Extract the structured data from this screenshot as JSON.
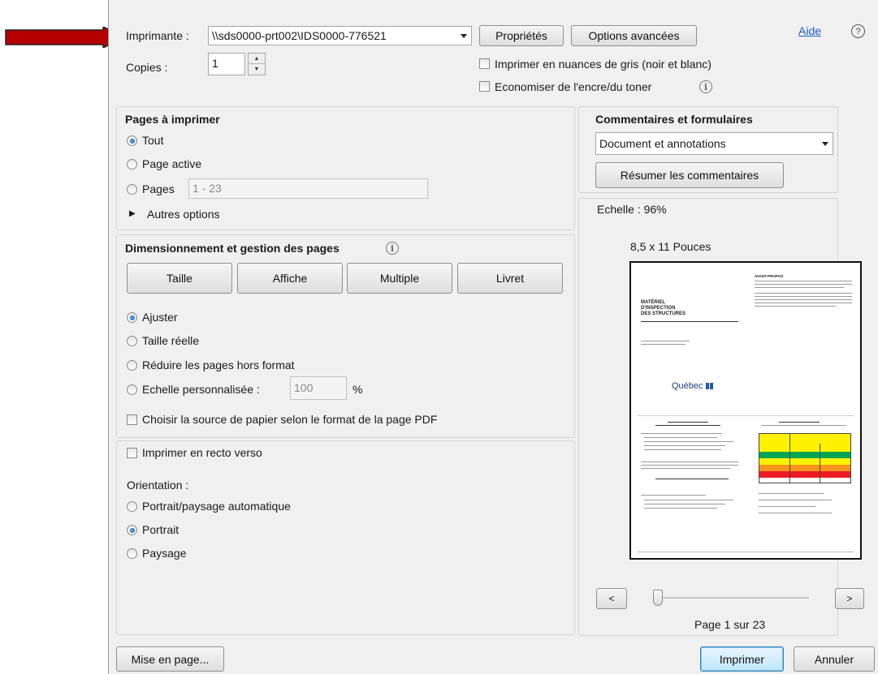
{
  "printer": {
    "label": "Imprimante :",
    "value": "\\\\sds0000-prt002\\IDS0000-776521",
    "properties_button": "Propriétés",
    "advanced_button": "Options avancées"
  },
  "help": {
    "label": "Aide"
  },
  "copies": {
    "label": "Copies :",
    "value": "1"
  },
  "options": {
    "grayscale": "Imprimer en nuances de gris (noir et blanc)",
    "save_ink": "Economiser de l'encre/du toner"
  },
  "pages_section": {
    "title": "Pages à imprimer",
    "all": "Tout",
    "current": "Page active",
    "pages": "Pages",
    "pages_range": "1 - 23",
    "more_options": "Autres options"
  },
  "sizing_section": {
    "title": "Dimensionnement et gestion des pages",
    "tabs": [
      "Taille",
      "Affiche",
      "Multiple",
      "Livret"
    ],
    "fit": "Ajuster",
    "actual_size": "Taille réelle",
    "shrink": "Réduire les pages hors format",
    "custom_scale": "Echelle personnalisée :",
    "custom_scale_value": "100",
    "percent": "%",
    "paper_source": "Choisir la source de papier selon le format de la page PDF"
  },
  "duplex": {
    "label": "Imprimer en recto verso",
    "orientation_title": "Orientation :",
    "auto": "Portrait/paysage automatique",
    "portrait": "Portrait",
    "landscape": "Paysage"
  },
  "comments_section": {
    "title": "Commentaires et formulaires",
    "value": "Document et annotations",
    "summarize_button": "Résumer les commentaires"
  },
  "preview": {
    "scale": "Echelle : 96%",
    "paper_size": "8,5 x 11 Pouces",
    "prev": "<",
    "next": ">",
    "page_info": "Page 1 sur 23",
    "doc_title": "MATÉRIEL\nD'INSPECTION\nDES STRUCTURES",
    "publisher": "Québec",
    "section_heading": "AVANT-PROPOS"
  },
  "footer": {
    "page_setup": "Mise en page...",
    "print": "Imprimer",
    "cancel": "Annuler"
  },
  "colors": {
    "arrow": "#b40000",
    "green": "#00a651",
    "yellow": "#fff200",
    "orange": "#f7941d",
    "red": "#ed1c24"
  }
}
